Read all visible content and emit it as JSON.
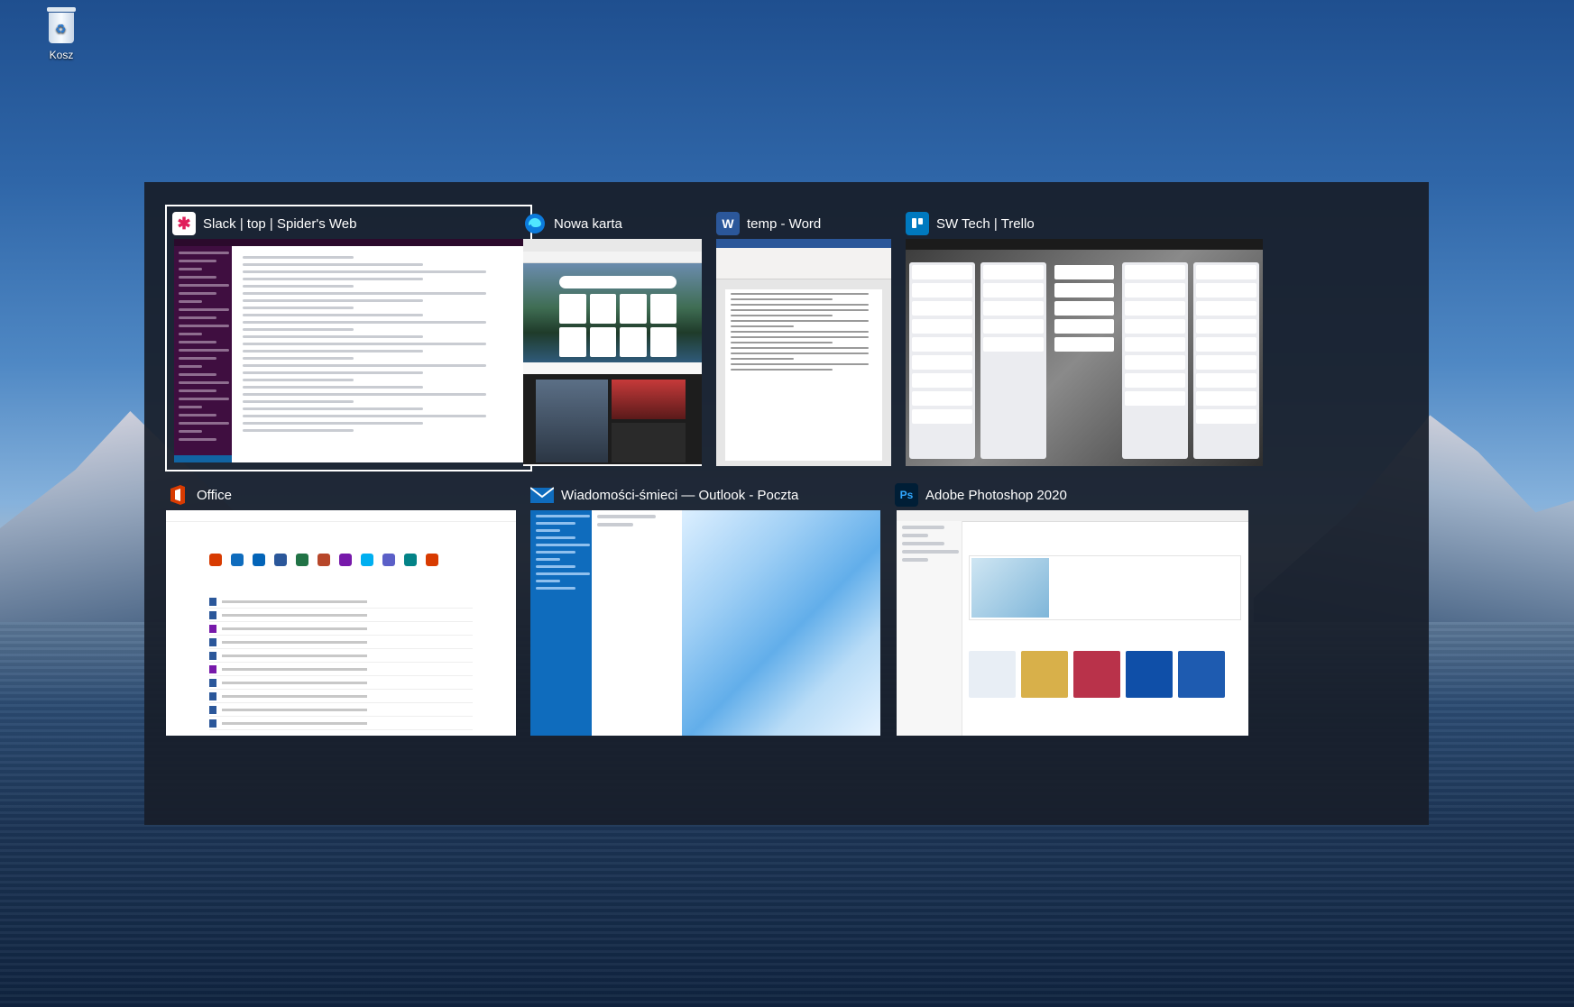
{
  "desktop": {
    "recycle_bin_label": "Kosz"
  },
  "switcher": {
    "windows": [
      {
        "id": "slack",
        "title": "Slack | top | Spider's Web",
        "icon": "slack-icon",
        "selected": true
      },
      {
        "id": "edge",
        "title": "Nowa karta",
        "icon": "edge-icon",
        "selected": false
      },
      {
        "id": "word",
        "title": "temp - Word",
        "icon": "word-icon",
        "selected": false
      },
      {
        "id": "trello",
        "title": "SW Tech | Trello",
        "icon": "trello-icon",
        "selected": false
      },
      {
        "id": "office",
        "title": "Office",
        "icon": "office-icon",
        "selected": false
      },
      {
        "id": "outlook",
        "title": "Wiadomości-śmieci — Outlook - Poczta",
        "icon": "mail-icon",
        "selected": false
      },
      {
        "id": "photoshop",
        "title": "Adobe Photoshop 2020",
        "icon": "photoshop-icon",
        "selected": false
      }
    ]
  },
  "icons": {
    "slack": "#4a154b",
    "edge": "#0c7bdc",
    "word": "#2b579a",
    "trello": "#0079bf",
    "office": "#d83b01",
    "outlook": "#0f6cbd",
    "photoshop": "#001e36"
  },
  "icon_glyphs": {
    "word": "W",
    "photoshop": "Ps"
  }
}
